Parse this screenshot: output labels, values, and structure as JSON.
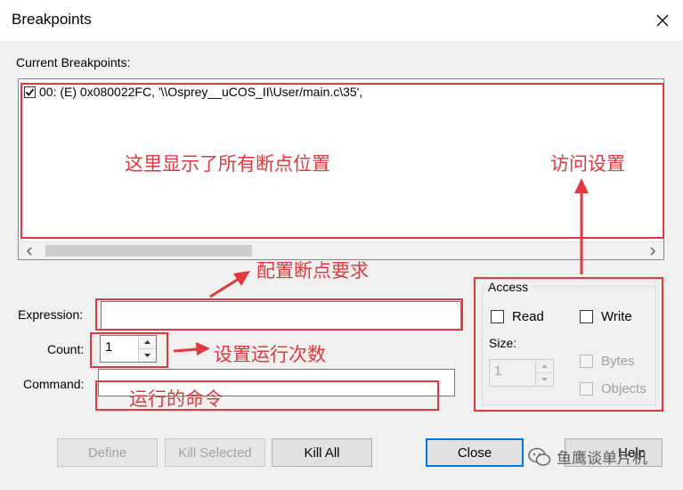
{
  "window": {
    "title": "Breakpoints"
  },
  "current_breakpoints": {
    "label": "Current Breakpoints:",
    "items": [
      {
        "checked": true,
        "text": "00: (E) 0x080022FC,  '\\\\Osprey__uCOS_II\\User/main.c\\35',"
      }
    ]
  },
  "expression": {
    "label": "Expression:",
    "value": ""
  },
  "count": {
    "label": "Count:",
    "value": "1"
  },
  "command": {
    "label": "Command:",
    "value": ""
  },
  "access": {
    "title": "Access",
    "read_label": "Read",
    "write_label": "Write",
    "size_label": "Size:",
    "size_value": "1",
    "bytes_label": "Bytes",
    "objects_label": "Objects"
  },
  "buttons": {
    "define": "Define",
    "kill_selected": "Kill Selected",
    "kill_all": "Kill All",
    "close": "Close",
    "help": "Help"
  },
  "annotations": {
    "list": "这里显示了所有断点位置",
    "access": "访问设置",
    "expression": "配置断点要求",
    "count": "设置运行次数",
    "command": "运行的命令"
  },
  "watermark": "鱼鹰谈单片机",
  "colors": {
    "annotation": "#e0383d",
    "accent": "#0078d7"
  }
}
